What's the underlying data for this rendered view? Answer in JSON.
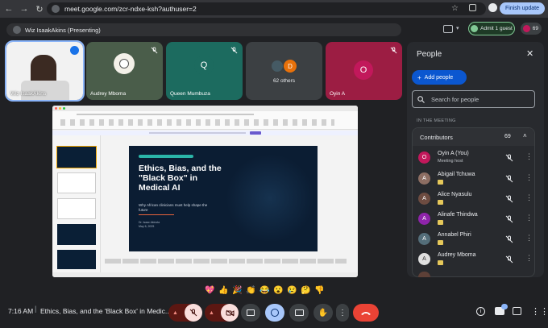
{
  "browser": {
    "url": "meet.google.com/zcr-ndxe-ksh?authuser=2",
    "update_label": "Finish update"
  },
  "meeting": {
    "presenting_label": "Wiz IsaakAkins (Presenting)",
    "admit_label": "Admit 1 guest",
    "participant_count": "69",
    "time": "7:16 AM",
    "title": "Ethics, Bias, and the 'Black Box' in Medic..."
  },
  "tiles": [
    {
      "name": "Wiz IsaakAkins",
      "bg": "#f2f2f2"
    },
    {
      "name": "Audrey Mboma",
      "bg": "#4a5d4a"
    },
    {
      "name": "Queen Mumbuza",
      "initial": "Q",
      "bg": "#1c6b5f"
    },
    {
      "name": "62 others",
      "initial": "D",
      "bg": "#3c4043"
    },
    {
      "name": "Oyin A",
      "initial": "O",
      "bg": "#9c1d43"
    }
  ],
  "slide": {
    "title": "Ethics, Bias, and the \"Black Box\" in Medical AI",
    "subtitle": "Why African clinicians must help shape the future",
    "author": "Dr. Isaac Akinola",
    "date": "May 6, 2025"
  },
  "reactions": [
    "💖",
    "👍",
    "🎉",
    "👏",
    "😂",
    "😮",
    "😢",
    "🤔",
    "👎"
  ],
  "panel": {
    "title": "People",
    "add_label": "Add people",
    "search_placeholder": "Search for people",
    "section_label": "IN THE MEETING",
    "group_label": "Contributors",
    "group_count": "69",
    "people": [
      {
        "name": "Oyin A (You)",
        "sub": "Meeting host",
        "initial": "O",
        "color": "#9c1d43"
      },
      {
        "name": "Abigail Tchuwa",
        "initial": "A",
        "color": "#8d6e63"
      },
      {
        "name": "Alice Nyasulu",
        "initial": "A",
        "color": "#6d4c41"
      },
      {
        "name": "Alinafe Thindwa",
        "initial": "A",
        "color": "#8e24aa"
      },
      {
        "name": "Annabel Phiri",
        "initial": "A",
        "color": "#546e7a"
      },
      {
        "name": "Audrey Mboma",
        "initial": "A",
        "color": "#e0e0e0"
      }
    ]
  },
  "colors": {
    "accent": "#8ab4f8",
    "end_call": "#ea4335",
    "mute_bg": "#f9dedc"
  }
}
